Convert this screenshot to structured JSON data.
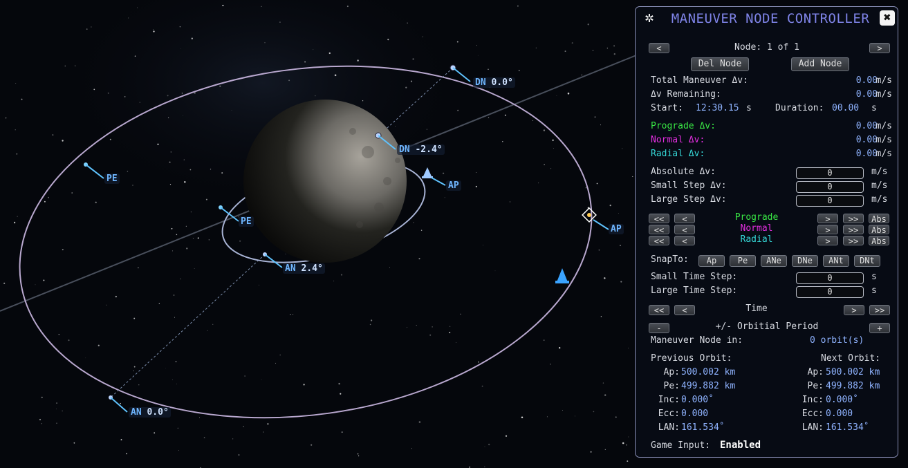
{
  "map": {
    "labels": {
      "dn_outer": {
        "kind": "DN",
        "value": "0.0°"
      },
      "dn_inner": {
        "kind": "DN",
        "value": "-2.4°"
      },
      "pe_outer": {
        "kind": "PE"
      },
      "pe_inner": {
        "kind": "PE"
      },
      "ap_inner": {
        "kind": "AP"
      },
      "ap_outer": {
        "kind": "AP"
      },
      "an_inner": {
        "kind": "AN",
        "value": "2.4°"
      },
      "an_outer": {
        "kind": "AN",
        "value": "0.0°"
      }
    }
  },
  "panel": {
    "title": "MANEUVER NODE CONTROLLER",
    "close_glyph": "✖",
    "gear_glyph": "✲",
    "node_label": "Node: 1 of 1",
    "prev_node": "<",
    "next_node": ">",
    "del_node": "Del Node",
    "add_node": "Add Node",
    "total_dv": {
      "label": "Total Maneuver Δv:",
      "value": "0.00",
      "unit": "m/s"
    },
    "dv_remaining": {
      "label": "Δv Remaining:",
      "value": "0.00",
      "unit": "m/s"
    },
    "start": {
      "label": "Start:",
      "value": "12:30.15",
      "unit": "s"
    },
    "duration": {
      "label": "Duration:",
      "value": "00.00",
      "unit": "s"
    },
    "prograde_dv": {
      "label": "Prograde Δv:",
      "value": "0.00",
      "unit": "m/s"
    },
    "normal_dv": {
      "label": "Normal Δv:",
      "value": "0.00",
      "unit": "m/s"
    },
    "radial_dv": {
      "label": "Radial Δv:",
      "value": "0.00",
      "unit": "m/s"
    },
    "absolute_dv": {
      "label": "Absolute Δv:",
      "value": "0",
      "unit": "m/s"
    },
    "small_step_dv": {
      "label": "Small Step Δv:",
      "value": "0",
      "unit": "m/s"
    },
    "large_step_dv": {
      "label": "Large Step Δv:",
      "value": "0",
      "unit": "m/s"
    },
    "dir_rows": {
      "prograde": "Prograde",
      "normal": "Normal",
      "radial": "Radial"
    },
    "btn": {
      "ll": "<<",
      "l": "<",
      "r": ">",
      "rr": ">>",
      "abs": "Abs",
      "minus": "-",
      "plus": "+"
    },
    "snap": {
      "label": "SnapTo:",
      "ap": "Ap",
      "pe": "Pe",
      "ane": "ANe",
      "dne": "DNe",
      "ant": "ANt",
      "dnt": "DNt"
    },
    "small_time_step": {
      "label": "Small Time Step:",
      "value": "0",
      "unit": "s"
    },
    "large_time_step": {
      "label": "Large Time Step:",
      "value": "0",
      "unit": "s"
    },
    "time_label": "Time",
    "orbital_period_label": "+/- Orbitial Period",
    "maneuver_in": {
      "label": "Maneuver Node in:",
      "value": "0 orbit(s)"
    },
    "previous_orbit": {
      "heading": "Previous Orbit:",
      "ap": {
        "label": "Ap:",
        "value": "500.002 km"
      },
      "pe": {
        "label": "Pe:",
        "value": "499.882 km"
      },
      "inc": {
        "label": "Inc:",
        "value": "0.000˚"
      },
      "ecc": {
        "label": "Ecc:",
        "value": "0.000"
      },
      "lan": {
        "label": "LAN:",
        "value": "161.534˚"
      }
    },
    "next_orbit": {
      "heading": "Next Orbit:",
      "ap": {
        "label": "Ap:",
        "value": "500.002 km"
      },
      "pe": {
        "label": "Pe:",
        "value": "499.882 km"
      },
      "inc": {
        "label": "Inc:",
        "value": "0.000˚"
      },
      "ecc": {
        "label": "Ecc:",
        "value": "0.000"
      },
      "lan": {
        "label": "LAN:",
        "value": "161.534˚"
      }
    },
    "game_input": {
      "label": "Game Input:",
      "value": "Enabled"
    }
  },
  "colors": {
    "title": "#7f84e8",
    "prograde": "#39e845",
    "normal": "#e62fe2",
    "radial": "#35d9d9",
    "value": "#8fb3ff",
    "orbit": "#b9a8cf"
  }
}
